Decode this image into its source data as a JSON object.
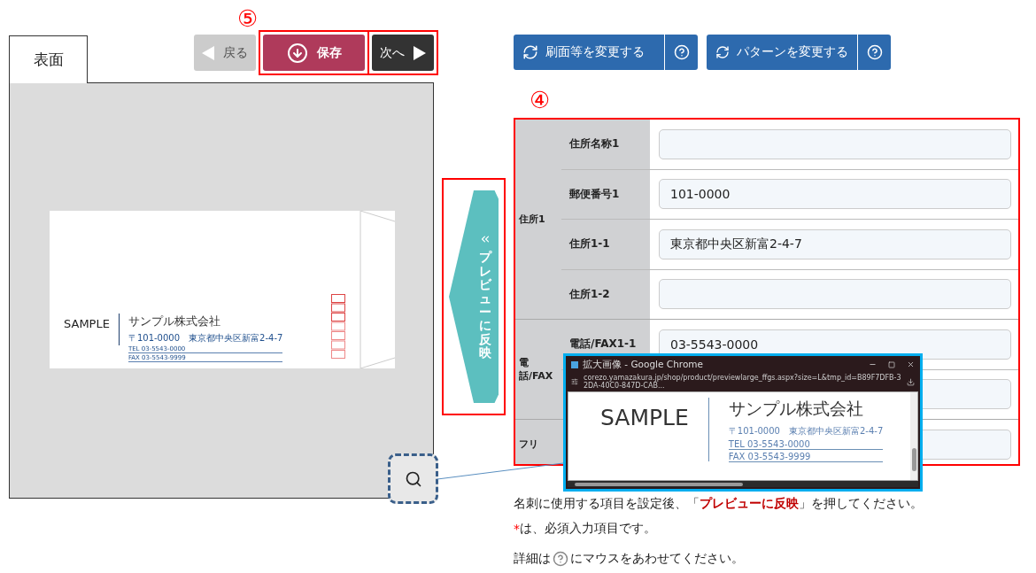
{
  "face_tab": {
    "label": "表面",
    "selected": true
  },
  "nav": {
    "step_mark": "⑤",
    "buttons": [
      {
        "kind": "back",
        "label": "戻る",
        "disabled": true
      },
      {
        "kind": "save",
        "label": "保存",
        "disabled": false
      },
      {
        "kind": "next",
        "label": "次へ",
        "disabled": false
      }
    ]
  },
  "envelope": {
    "name": "SAMPLE",
    "company": "サンプル株式会社",
    "address": "〒101-0000　東京都中央区新富2-4-7",
    "tel": "TEL 03-5543-0000",
    "fax": "FAX 03-5543-9999"
  },
  "reflect_button": {
    "label": "プレビューに反映"
  },
  "option_buttons": [
    {
      "label": "刷面等を変更する"
    },
    {
      "label": "パターンを変更する"
    }
  ],
  "form": {
    "step_mark": "④",
    "groups": [
      {
        "label": "住所1",
        "rows": [
          {
            "label": "住所名称1"
          },
          {
            "label": "郵便番号1",
            "value": "101-0000"
          },
          {
            "label": "住所1-1",
            "value": "東京都中央区新富2-4-7"
          },
          {
            "label": "住所1-2"
          }
        ]
      },
      {
        "label": "電話/FAX",
        "rows": [
          {
            "label": "電話/FAX1-1",
            "value": "03-5543-0000"
          },
          {}
        ]
      },
      {
        "label": "フリ",
        "rows": [
          {}
        ]
      }
    ]
  },
  "popup": {
    "title": "拡大画像 - Google Chrome",
    "url": "corezo.yamazakura.jp/shop/product/previewlarge_ffgs.aspx?size=L&tmp_id=B89F7DFB-32DA-40C0-847D-CAB...",
    "card": {
      "name": "SAMPLE",
      "company": "サンプル株式会社",
      "address": "〒101-0000　東京都中央区新富2-4-7",
      "tel": "TEL 03-5543-0000",
      "fax": "FAX 03-5543-9999"
    }
  },
  "notes": {
    "instruction": "名刺に使用する項目を設定後、「**プレビューに反映**」を押してください。",
    "required_mark": "*",
    "required_text": "は、必須入力項目です。",
    "help_before": "詳細は",
    "help_after": "にマウスをあわせてください。"
  }
}
